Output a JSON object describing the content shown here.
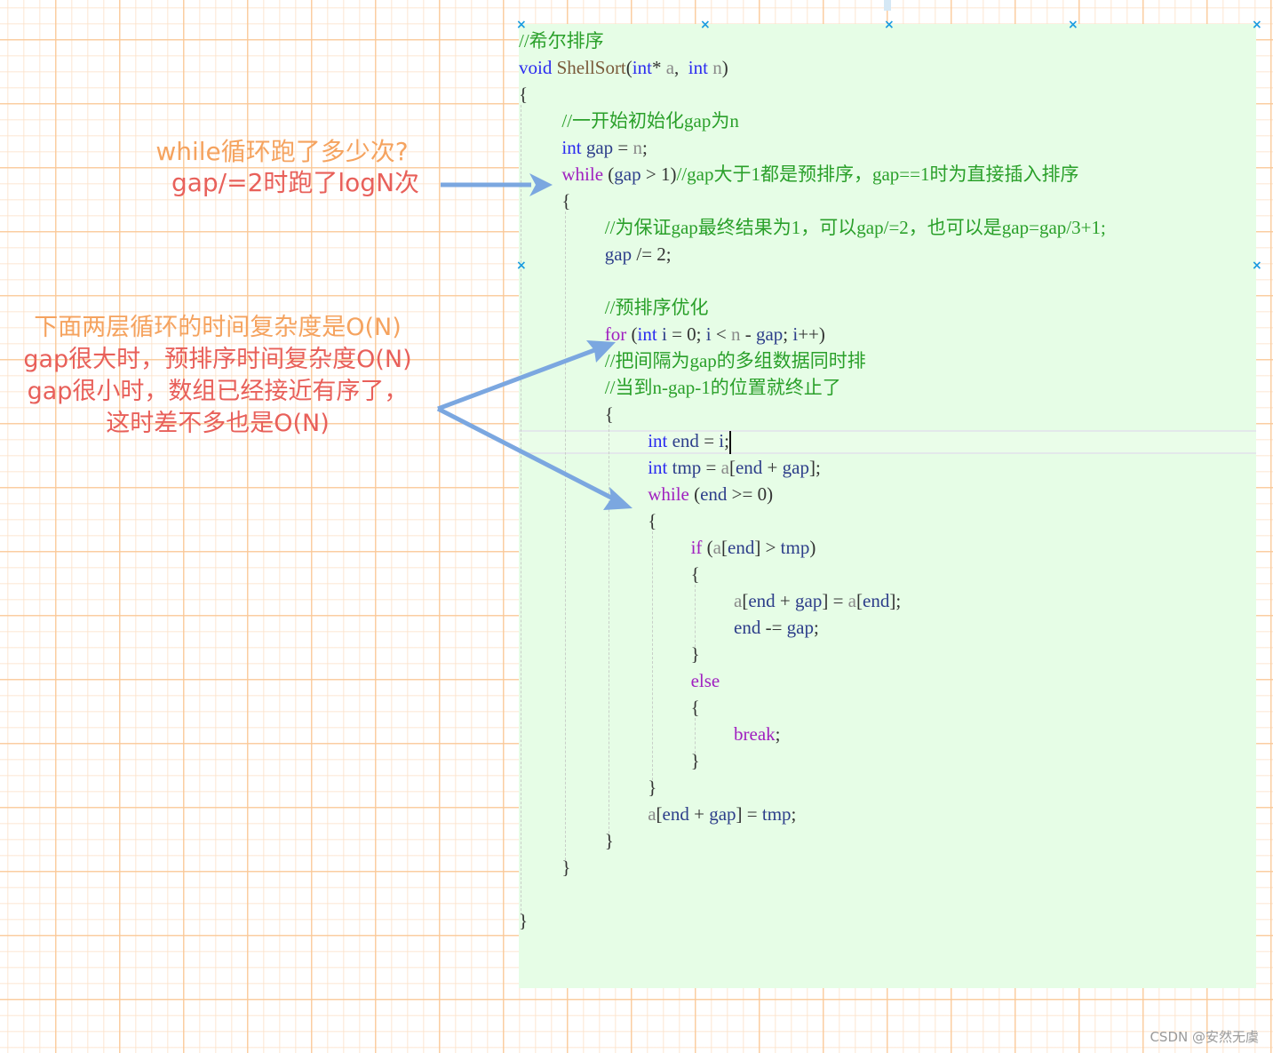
{
  "canvas": {
    "grid_major_color": "#facc96",
    "grid_minor_color": "#fce1c8",
    "code_box_background": "#e6fde6",
    "handle_color": "#1a9be0",
    "arrow_color": "#7ba7e0"
  },
  "code": {
    "lines": [
      {
        "indent": 0,
        "tokens": [
          {
            "t": "//希尔排序",
            "c": "cmt"
          }
        ]
      },
      {
        "indent": 0,
        "tokens": [
          {
            "t": "void",
            "c": "kw-type"
          },
          {
            "t": " ",
            "c": "punc"
          },
          {
            "t": "ShellSort",
            "c": "fn"
          },
          {
            "t": "(",
            "c": "punc"
          },
          {
            "t": "int",
            "c": "kw-type"
          },
          {
            "t": "* ",
            "c": "punc"
          },
          {
            "t": "a",
            "c": "param"
          },
          {
            "t": ",  ",
            "c": "punc"
          },
          {
            "t": "int",
            "c": "kw-type"
          },
          {
            "t": " ",
            "c": "punc"
          },
          {
            "t": "n",
            "c": "param"
          },
          {
            "t": ")",
            "c": "punc"
          }
        ]
      },
      {
        "indent": 0,
        "tokens": [
          {
            "t": "{",
            "c": "punc"
          }
        ]
      },
      {
        "indent": 1,
        "tokens": [
          {
            "t": "//一开始初始化gap为n",
            "c": "cmt"
          }
        ]
      },
      {
        "indent": 1,
        "tokens": [
          {
            "t": "int",
            "c": "kw-type"
          },
          {
            "t": " ",
            "c": "punc"
          },
          {
            "t": "gap",
            "c": "var"
          },
          {
            "t": " = ",
            "c": "punc"
          },
          {
            "t": "n",
            "c": "param"
          },
          {
            "t": ";",
            "c": "punc"
          }
        ]
      },
      {
        "indent": 1,
        "tokens": [
          {
            "t": "while",
            "c": "kw-ctrl"
          },
          {
            "t": " (",
            "c": "punc"
          },
          {
            "t": "gap",
            "c": "var"
          },
          {
            "t": " > 1)",
            "c": "punc"
          },
          {
            "t": "//gap大于1都是预排序，gap==1时为直接插入排序",
            "c": "cmt"
          }
        ]
      },
      {
        "indent": 1,
        "tokens": [
          {
            "t": "{",
            "c": "punc"
          }
        ]
      },
      {
        "indent": 2,
        "tokens": [
          {
            "t": "//为保证gap最终结果为1，可以gap/=2，也可以是gap=gap/3+1;",
            "c": "cmt"
          }
        ]
      },
      {
        "indent": 2,
        "tokens": [
          {
            "t": "gap",
            "c": "var"
          },
          {
            "t": " /= 2;",
            "c": "punc"
          }
        ]
      },
      {
        "indent": 2,
        "tokens": []
      },
      {
        "indent": 2,
        "tokens": [
          {
            "t": "//预排序优化",
            "c": "cmt"
          }
        ]
      },
      {
        "indent": 2,
        "tokens": [
          {
            "t": "for",
            "c": "kw-ctrl"
          },
          {
            "t": " (",
            "c": "punc"
          },
          {
            "t": "int",
            "c": "kw-type"
          },
          {
            "t": " ",
            "c": "punc"
          },
          {
            "t": "i",
            "c": "var"
          },
          {
            "t": " = 0; ",
            "c": "punc"
          },
          {
            "t": "i",
            "c": "var"
          },
          {
            "t": " < ",
            "c": "punc"
          },
          {
            "t": "n",
            "c": "param"
          },
          {
            "t": " - ",
            "c": "punc"
          },
          {
            "t": "gap",
            "c": "var"
          },
          {
            "t": "; ",
            "c": "punc"
          },
          {
            "t": "i",
            "c": "var"
          },
          {
            "t": "++)",
            "c": "punc"
          }
        ]
      },
      {
        "indent": 2,
        "tokens": [
          {
            "t": "//把间隔为gap的多组数据同时排",
            "c": "cmt"
          }
        ]
      },
      {
        "indent": 2,
        "tokens": [
          {
            "t": "//当到n-gap-1的位置就终止了",
            "c": "cmt"
          }
        ]
      },
      {
        "indent": 2,
        "tokens": [
          {
            "t": "{",
            "c": "punc"
          }
        ]
      },
      {
        "indent": 3,
        "tokens": [
          {
            "t": "int",
            "c": "kw-type"
          },
          {
            "t": " ",
            "c": "punc"
          },
          {
            "t": "end",
            "c": "var"
          },
          {
            "t": " = ",
            "c": "punc"
          },
          {
            "t": "i",
            "c": "var"
          },
          {
            "t": ";",
            "c": "punc"
          }
        ],
        "cursor": true
      },
      {
        "indent": 3,
        "tokens": [
          {
            "t": "int",
            "c": "kw-type"
          },
          {
            "t": " ",
            "c": "punc"
          },
          {
            "t": "tmp",
            "c": "var"
          },
          {
            "t": " = ",
            "c": "punc"
          },
          {
            "t": "a",
            "c": "param"
          },
          {
            "t": "[",
            "c": "punc"
          },
          {
            "t": "end",
            "c": "var"
          },
          {
            "t": " + ",
            "c": "punc"
          },
          {
            "t": "gap",
            "c": "var"
          },
          {
            "t": "];",
            "c": "punc"
          }
        ]
      },
      {
        "indent": 3,
        "tokens": [
          {
            "t": "while",
            "c": "kw-ctrl"
          },
          {
            "t": " (",
            "c": "punc"
          },
          {
            "t": "end",
            "c": "var"
          },
          {
            "t": " >= 0)",
            "c": "punc"
          }
        ]
      },
      {
        "indent": 3,
        "tokens": [
          {
            "t": "{",
            "c": "punc"
          }
        ]
      },
      {
        "indent": 4,
        "tokens": [
          {
            "t": "if",
            "c": "kw-ctrl"
          },
          {
            "t": " (",
            "c": "punc"
          },
          {
            "t": "a",
            "c": "param"
          },
          {
            "t": "[",
            "c": "punc"
          },
          {
            "t": "end",
            "c": "var"
          },
          {
            "t": "] > ",
            "c": "punc"
          },
          {
            "t": "tmp",
            "c": "var"
          },
          {
            "t": ")",
            "c": "punc"
          }
        ]
      },
      {
        "indent": 4,
        "tokens": [
          {
            "t": "{",
            "c": "punc"
          }
        ]
      },
      {
        "indent": 5,
        "tokens": [
          {
            "t": "a",
            "c": "param"
          },
          {
            "t": "[",
            "c": "punc"
          },
          {
            "t": "end",
            "c": "var"
          },
          {
            "t": " + ",
            "c": "punc"
          },
          {
            "t": "gap",
            "c": "var"
          },
          {
            "t": "] = ",
            "c": "punc"
          },
          {
            "t": "a",
            "c": "param"
          },
          {
            "t": "[",
            "c": "punc"
          },
          {
            "t": "end",
            "c": "var"
          },
          {
            "t": "];",
            "c": "punc"
          }
        ]
      },
      {
        "indent": 5,
        "tokens": [
          {
            "t": "end",
            "c": "var"
          },
          {
            "t": " -= ",
            "c": "punc"
          },
          {
            "t": "gap",
            "c": "var"
          },
          {
            "t": ";",
            "c": "punc"
          }
        ]
      },
      {
        "indent": 4,
        "tokens": [
          {
            "t": "}",
            "c": "punc"
          }
        ]
      },
      {
        "indent": 4,
        "tokens": [
          {
            "t": "else",
            "c": "kw-ctrl"
          }
        ]
      },
      {
        "indent": 4,
        "tokens": [
          {
            "t": "{",
            "c": "punc"
          }
        ]
      },
      {
        "indent": 5,
        "tokens": [
          {
            "t": "break",
            "c": "kw-ctrl"
          },
          {
            "t": ";",
            "c": "punc"
          }
        ]
      },
      {
        "indent": 4,
        "tokens": [
          {
            "t": "}",
            "c": "punc"
          }
        ]
      },
      {
        "indent": 3,
        "tokens": [
          {
            "t": "}",
            "c": "punc"
          }
        ]
      },
      {
        "indent": 3,
        "tokens": [
          {
            "t": "a",
            "c": "param"
          },
          {
            "t": "[",
            "c": "punc"
          },
          {
            "t": "end",
            "c": "var"
          },
          {
            "t": " + ",
            "c": "punc"
          },
          {
            "t": "gap",
            "c": "var"
          },
          {
            "t": "] = ",
            "c": "punc"
          },
          {
            "t": "tmp",
            "c": "var"
          },
          {
            "t": ";",
            "c": "punc"
          }
        ]
      },
      {
        "indent": 2,
        "tokens": [
          {
            "t": "}",
            "c": "punc"
          }
        ]
      },
      {
        "indent": 1,
        "tokens": [
          {
            "t": "}",
            "c": "punc"
          }
        ]
      },
      {
        "indent": 1,
        "tokens": []
      },
      {
        "indent": 0,
        "tokens": [
          {
            "t": "}",
            "c": "punc"
          }
        ]
      }
    ]
  },
  "annotations": {
    "while_note": {
      "line1": "while循环跑了多少次?",
      "line2": "gap/=2时跑了logN次"
    },
    "loop_note": {
      "line1": "下面两层循环的时间复杂度是O(N)",
      "line2": "gap很大时，预排序时间复杂度O(N)",
      "line3": "gap很小时，数组已经接近有序了，",
      "line4": "这时差不多也是O(N)"
    }
  },
  "watermark": "CSDN @安然无虞"
}
